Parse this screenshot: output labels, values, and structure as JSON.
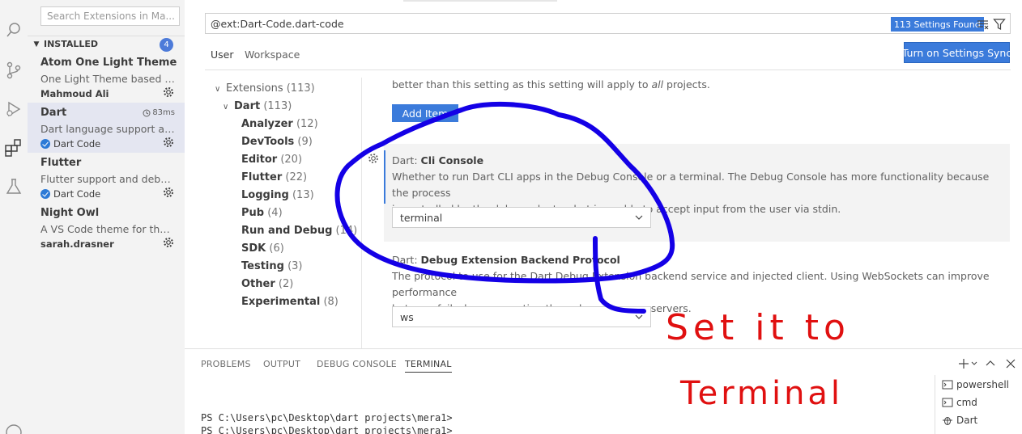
{
  "sidebar": {
    "search_placeholder": "Search Extensions in Ma...",
    "section_title": "INSTALLED",
    "section_count": "4",
    "extensions": [
      {
        "name": "Atom One Light Theme",
        "description": "One Light Theme based on...",
        "author": "Mahmoud Ali",
        "verified": false
      },
      {
        "name": "Dart",
        "description": "Dart language support and...",
        "author": "Dart Code",
        "verified": true,
        "activation_time": "83ms"
      },
      {
        "name": "Flutter",
        "description": "Flutter support and debug...",
        "author": "Dart Code",
        "verified": true
      },
      {
        "name": "Night Owl",
        "description": "A VS Code theme for the ni...",
        "author": "sarah.drasner",
        "verified": false
      }
    ]
  },
  "settings": {
    "search_value": "@ext:Dart-Code.dart-code",
    "found_badge": "113 Settings Found",
    "tabs": [
      "User",
      "Workspace"
    ],
    "sync_button": "Turn on Settings Sync",
    "toc": [
      {
        "label": "Extensions",
        "count": "(113)"
      },
      {
        "label": "Dart",
        "count": "(113)"
      },
      {
        "label": "Analyzer",
        "count": "(12)"
      },
      {
        "label": "DevTools",
        "count": "(9)"
      },
      {
        "label": "Editor",
        "count": "(20)"
      },
      {
        "label": "Flutter",
        "count": "(22)"
      },
      {
        "label": "Logging",
        "count": "(13)"
      },
      {
        "label": "Pub",
        "count": "(4)"
      },
      {
        "label": "Run and Debug",
        "count": "(14)"
      },
      {
        "label": "SDK",
        "count": "(6)"
      },
      {
        "label": "Testing",
        "count": "(3)"
      },
      {
        "label": "Other",
        "count": "(2)"
      },
      {
        "label": "Experimental",
        "count": "(8)"
      }
    ],
    "truncated_desc_pre": "better than this setting as this setting will apply to ",
    "truncated_desc_em": "all",
    "truncated_desc_post": " projects.",
    "add_item": "Add Item",
    "cli_console": {
      "category": "Dart: ",
      "name": "Cli Console",
      "desc_line1": "Whether to run Dart CLI apps in the Debug Console or a terminal. The Debug Console has more functionality because the process",
      "desc_line2": "is controlled by the debug adapter, but is unable to accept input from the user via stdin.",
      "value": "terminal"
    },
    "backend_protocol": {
      "category": "Dart: ",
      "name": "Debug Extension Backend Protocol",
      "desc_line1": "The protocol to use for the Dart Debug Extension backend service and injected client. Using WebSockets can improve performance",
      "desc_line2": "but may fail when connecting through some proxy servers.",
      "value": "ws"
    }
  },
  "panel": {
    "tabs": [
      "PROBLEMS",
      "OUTPUT",
      "DEBUG CONSOLE",
      "TERMINAL"
    ],
    "terminal_lines": "PS C:\\Users\\pc\\Desktop\\dart projects\\mera1>\nPS C:\\Users\\pc\\Desktop\\dart projects\\mera1>",
    "terminals": [
      "powershell",
      "cmd",
      "Dart"
    ]
  },
  "annotation": {
    "line1": "Set it to",
    "line2": "Terminal",
    "circle_color": "#1400e6",
    "text_color": "#e01010"
  },
  "colors": {
    "accent": "#3b7bdb",
    "badge": "#4d7bd9"
  }
}
